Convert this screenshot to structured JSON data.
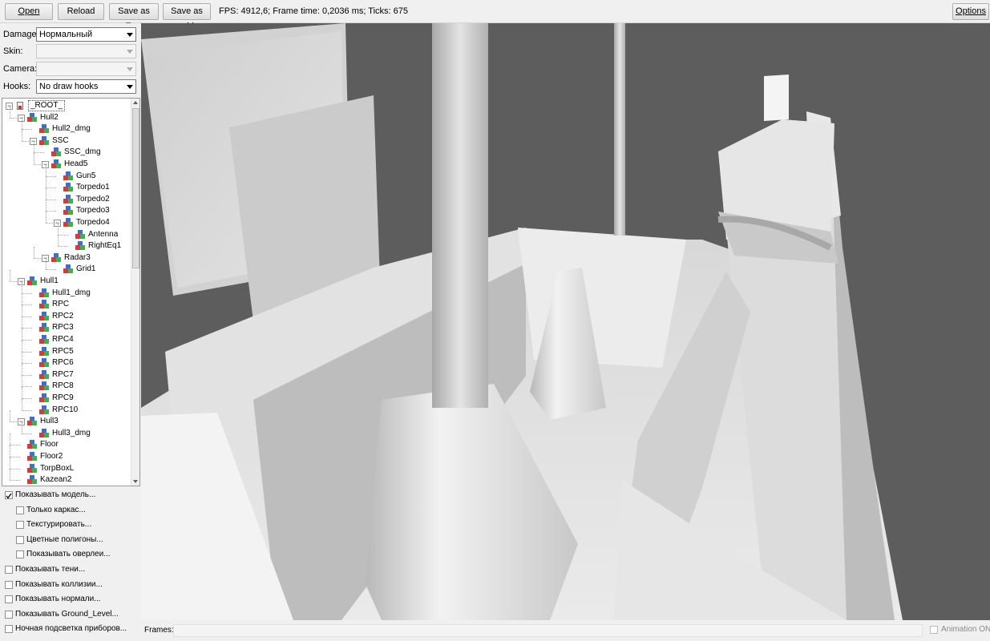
{
  "toolbar": {
    "open": "Open",
    "reload": "Reload",
    "save_text": "Save as Text",
    "save_obj": "Save as .obj",
    "options": "Options",
    "status": "FPS: 4912,6; Frame time: 0,2036 ms; Ticks: 675"
  },
  "controls": {
    "damage_label": "Damage:",
    "damage_value": "Нормальный",
    "skin_label": "Skin:",
    "skin_value": "",
    "camera_label": "Camera:",
    "camera_value": "",
    "hooks_label": "Hooks:",
    "hooks_value": "No draw hooks"
  },
  "tree": [
    {
      "label": "_ROOT_",
      "depth": 0,
      "toggle": "-",
      "root": true
    },
    {
      "label": "Hull2",
      "depth": 1,
      "toggle": "-"
    },
    {
      "label": "Hull2_dmg",
      "depth": 2,
      "toggle": ""
    },
    {
      "label": "SSC",
      "depth": 2,
      "toggle": "-"
    },
    {
      "label": "SSC_dmg",
      "depth": 3,
      "toggle": ""
    },
    {
      "label": "Head5",
      "depth": 3,
      "toggle": "-"
    },
    {
      "label": "Gun5",
      "depth": 4,
      "toggle": ""
    },
    {
      "label": "Torpedo1",
      "depth": 4,
      "toggle": ""
    },
    {
      "label": "Torpedo2",
      "depth": 4,
      "toggle": ""
    },
    {
      "label": "Torpedo3",
      "depth": 4,
      "toggle": ""
    },
    {
      "label": "Torpedo4",
      "depth": 4,
      "toggle": "-"
    },
    {
      "label": "Antenna",
      "depth": 5,
      "toggle": ""
    },
    {
      "label": "RightEq1",
      "depth": 5,
      "toggle": ""
    },
    {
      "label": "Radar3",
      "depth": 3,
      "toggle": "-"
    },
    {
      "label": "Grid1",
      "depth": 4,
      "toggle": ""
    },
    {
      "label": "Hull1",
      "depth": 1,
      "toggle": "-"
    },
    {
      "label": "Hull1_dmg",
      "depth": 2,
      "toggle": ""
    },
    {
      "label": "RPC",
      "depth": 2,
      "toggle": ""
    },
    {
      "label": "RPC2",
      "depth": 2,
      "toggle": ""
    },
    {
      "label": "RPC3",
      "depth": 2,
      "toggle": ""
    },
    {
      "label": "RPC4",
      "depth": 2,
      "toggle": ""
    },
    {
      "label": "RPC5",
      "depth": 2,
      "toggle": ""
    },
    {
      "label": "RPC6",
      "depth": 2,
      "toggle": ""
    },
    {
      "label": "RPC7",
      "depth": 2,
      "toggle": ""
    },
    {
      "label": "RPC8",
      "depth": 2,
      "toggle": ""
    },
    {
      "label": "RPC9",
      "depth": 2,
      "toggle": ""
    },
    {
      "label": "RPC10",
      "depth": 2,
      "toggle": ""
    },
    {
      "label": "Hull3",
      "depth": 1,
      "toggle": "-"
    },
    {
      "label": "Hull3_dmg",
      "depth": 2,
      "toggle": ""
    },
    {
      "label": "Floor",
      "depth": 1,
      "toggle": ""
    },
    {
      "label": "Floor2",
      "depth": 1,
      "toggle": ""
    },
    {
      "label": "TorpBoxL",
      "depth": 1,
      "toggle": ""
    },
    {
      "label": "Kazean2",
      "depth": 1,
      "toggle": ""
    }
  ],
  "checkboxes": [
    {
      "label": "Показывать модель...",
      "checked": true,
      "indent": 0
    },
    {
      "label": "Только каркас...",
      "checked": false,
      "indent": 1
    },
    {
      "label": "Текстурировать...",
      "checked": false,
      "indent": 1
    },
    {
      "label": "Цветные полигоны...",
      "checked": false,
      "indent": 1
    },
    {
      "label": "Показывать оверлеи...",
      "checked": false,
      "indent": 1
    },
    {
      "label": "Показывать тени...",
      "checked": false,
      "indent": 0
    },
    {
      "label": "Показывать коллизии...",
      "checked": false,
      "indent": 0
    },
    {
      "label": "Показывать нормали...",
      "checked": false,
      "indent": 0
    },
    {
      "label": "Показывать Ground_Level...",
      "checked": false,
      "indent": 0
    },
    {
      "label": "Ночная подсветка приборов...",
      "checked": false,
      "indent": 0
    }
  ],
  "bottom": {
    "frames_label": "Frames:",
    "animation_label": "Animation ON"
  },
  "icon_names": {
    "node": "model-node-icon",
    "root": "root-node-icon"
  }
}
